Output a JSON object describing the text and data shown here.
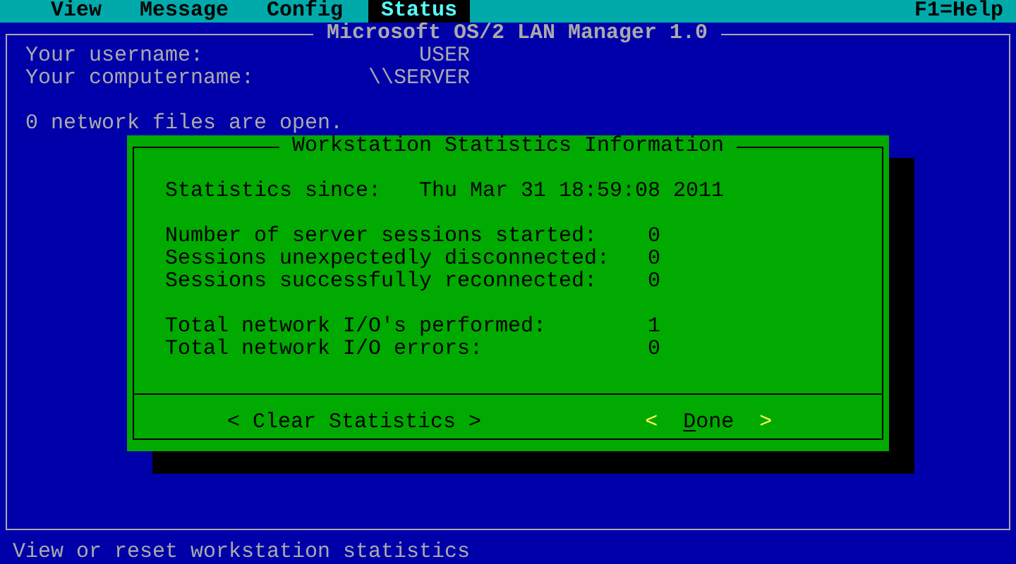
{
  "menu_bar": {
    "items": [
      {
        "label": "View",
        "selected": false
      },
      {
        "label": "Message",
        "selected": false
      },
      {
        "label": "Config",
        "selected": false
      },
      {
        "label": "Status",
        "selected": true
      }
    ],
    "help": "F1=Help"
  },
  "window": {
    "title": "Microsoft OS/2 LAN Manager 1.0",
    "fields": [
      {
        "label": "Your username:",
        "value": "USER"
      },
      {
        "label": "Your computername:",
        "value": "\\\\SERVER"
      }
    ],
    "open_files": "0 network files are open."
  },
  "dialog": {
    "title": "Workstation Statistics Information",
    "since": {
      "label": "Statistics since:",
      "value": "Thu Mar 31 18:59:08 2011"
    },
    "groups": [
      [
        {
          "label": "Number of server sessions started:",
          "value": "0"
        },
        {
          "label": "Sessions unexpectedly disconnected:",
          "value": "0"
        },
        {
          "label": "Sessions successfully reconnected:",
          "value": "0"
        }
      ],
      [
        {
          "label": "Total network I/O's performed:",
          "value": "1"
        },
        {
          "label": "Total network I/O errors:",
          "value": "0"
        }
      ]
    ],
    "buttons": [
      {
        "open": "<",
        "label": "Clear Statistics",
        "close": ">",
        "selected": false,
        "mnemonic": false
      },
      {
        "open": "<",
        "label": "Done",
        "close": ">",
        "selected": true,
        "mnemonic": true
      }
    ]
  },
  "status_bar": "View or reset workstation statistics"
}
